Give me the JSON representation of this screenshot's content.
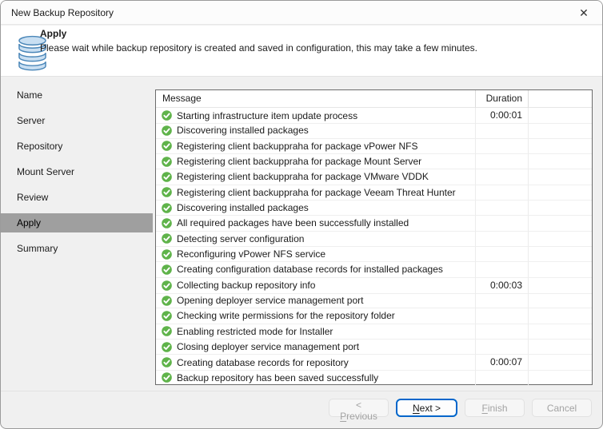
{
  "window": {
    "title": "New Backup Repository",
    "close_glyph": "✕"
  },
  "header": {
    "step_title": "Apply",
    "description": "Please wait while backup repository is created and saved in configuration, this may take a few minutes."
  },
  "sidebar": {
    "items": [
      {
        "label": "Name"
      },
      {
        "label": "Server"
      },
      {
        "label": "Repository"
      },
      {
        "label": "Mount Server"
      },
      {
        "label": "Review"
      },
      {
        "label": "Apply"
      },
      {
        "label": "Summary"
      }
    ],
    "selected": "Apply"
  },
  "table": {
    "columns": {
      "message": "Message",
      "duration": "Duration"
    },
    "rows": [
      {
        "message": "Starting infrastructure item update process",
        "duration": "0:00:01"
      },
      {
        "message": "Discovering installed packages",
        "duration": ""
      },
      {
        "message": "Registering client backuppraha for package vPower NFS",
        "duration": ""
      },
      {
        "message": "Registering client backuppraha for package Mount Server",
        "duration": ""
      },
      {
        "message": "Registering client backuppraha for package VMware VDDK",
        "duration": ""
      },
      {
        "message": "Registering client backuppraha for package Veeam Threat Hunter",
        "duration": ""
      },
      {
        "message": "Discovering installed packages",
        "duration": ""
      },
      {
        "message": "All required packages have been successfully installed",
        "duration": ""
      },
      {
        "message": "Detecting server configuration",
        "duration": ""
      },
      {
        "message": "Reconfiguring vPower NFS service",
        "duration": ""
      },
      {
        "message": "Creating configuration database records for installed packages",
        "duration": ""
      },
      {
        "message": "Collecting backup repository info",
        "duration": "0:00:03"
      },
      {
        "message": "Opening deployer service management port",
        "duration": ""
      },
      {
        "message": "Checking write permissions for the repository folder",
        "duration": ""
      },
      {
        "message": "Enabling restricted mode for Installer",
        "duration": ""
      },
      {
        "message": "Closing deployer service management port",
        "duration": ""
      },
      {
        "message": "Creating database records for repository",
        "duration": "0:00:07"
      },
      {
        "message": "Backup repository has been saved successfully",
        "duration": ""
      }
    ]
  },
  "footer": {
    "buttons": {
      "previous": {
        "pre": "< ",
        "accel": "P",
        "post": "revious"
      },
      "next": {
        "pre": "",
        "accel": "N",
        "post": "ext >"
      },
      "finish": {
        "pre": "",
        "accel": "F",
        "post": "inish"
      },
      "cancel": {
        "pre": "Cancel",
        "accel": "",
        "post": ""
      }
    }
  },
  "colors": {
    "accent_blue": "#0066cb",
    "status_green": "#5fb34a",
    "selected_step_gray": "#9f9f9f",
    "icon_blue_fill": "#c9dff2",
    "icon_blue_stroke": "#4a86b8"
  }
}
